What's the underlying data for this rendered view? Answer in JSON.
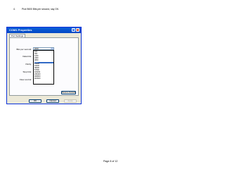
{
  "instruction": {
    "bullet": "4.",
    "text": "Pick 9600 Bits per second, say OK."
  },
  "dialog": {
    "title": "COM1 Properties",
    "tab": "Port Settings",
    "labels": {
      "bits_per_second": "Bits per second:",
      "data_bits": "Data bits:",
      "parity": "Parity:",
      "stop_bits": "Stop bits:",
      "flow_control": "Flow control:"
    },
    "bits_per_second_value": "9600",
    "options": [
      "110",
      "300",
      "1200",
      "2400",
      "4800",
      "9600",
      "14400",
      "19200",
      "38400",
      "57600",
      "115200",
      "230400",
      "460800",
      "921600"
    ],
    "selected_option": "9600",
    "restore_defaults": "Restore Defaults",
    "ok": "OK",
    "cancel": "Cancel",
    "apply": "Apply"
  },
  "footer": "Page 8 of 12"
}
